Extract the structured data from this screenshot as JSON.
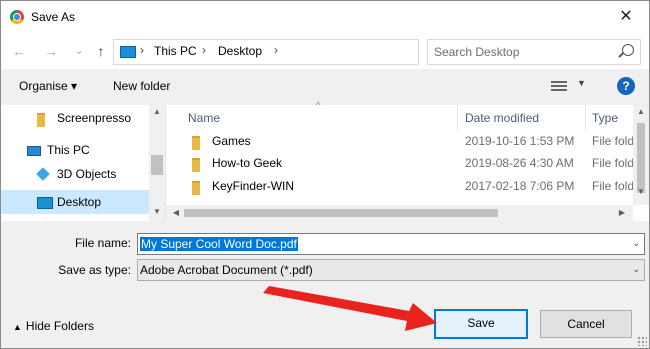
{
  "window": {
    "title": "Save As"
  },
  "nav": {
    "back": "←",
    "forward": "→",
    "recent": "⌄",
    "up": "↑",
    "breadcrumb": [
      "This PC",
      "Desktop"
    ],
    "search_placeholder": "Search Desktop"
  },
  "toolbar": {
    "organise": "Organise ▾",
    "new_folder": "New folder",
    "help": "?"
  },
  "sidebar": {
    "items": [
      {
        "label": "Screenpresso",
        "icon": "folder-icon"
      },
      {
        "label": "This PC",
        "icon": "computer-icon"
      },
      {
        "label": "3D Objects",
        "icon": "3d-objects-icon"
      },
      {
        "label": "Desktop",
        "icon": "desktop-icon",
        "selected": true
      }
    ]
  },
  "file_list": {
    "columns": [
      "Name",
      "Date modified",
      "Type"
    ],
    "rows": [
      {
        "name": "Games",
        "date": "2019-10-16 1:53 PM",
        "type": "File folder"
      },
      {
        "name": "How-to Geek",
        "date": "2019-08-26 4:30 AM",
        "type": "File folder"
      },
      {
        "name": "KeyFinder-WIN",
        "date": "2017-02-18 7:06 PM",
        "type": "File folder"
      }
    ]
  },
  "form": {
    "file_name_label": "File name:",
    "file_name_value": "My Super Cool Word Doc.pdf",
    "save_type_label": "Save as type:",
    "save_type_value": "Adobe Acrobat Document (*.pdf)"
  },
  "footer": {
    "hide_folders": "Hide Folders",
    "save": "Save",
    "cancel": "Cancel"
  },
  "colors": {
    "accent": "#0078d7",
    "selection": "#cce8ff",
    "annotation_arrow": "#e8221c",
    "help": "#1565c0"
  }
}
